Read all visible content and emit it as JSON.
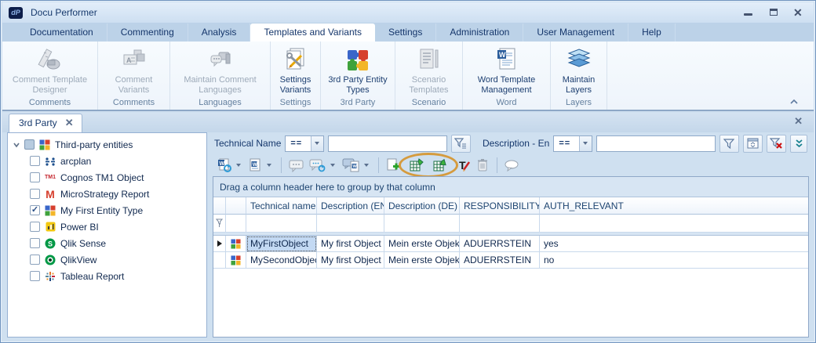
{
  "window": {
    "title": "Docu Performer",
    "logo_text": "dP"
  },
  "menu_tabs": [
    {
      "label": "Documentation"
    },
    {
      "label": "Commenting"
    },
    {
      "label": "Analysis"
    },
    {
      "label": "Templates and Variants"
    },
    {
      "label": "Settings"
    },
    {
      "label": "Administration"
    },
    {
      "label": "User Management"
    },
    {
      "label": "Help"
    }
  ],
  "ribbon": {
    "buttons": [
      {
        "label": "Comment Template Designer",
        "caption": "Comments",
        "disabled": true
      },
      {
        "label": "Comment Variants",
        "caption": "Comments",
        "disabled": true
      },
      {
        "label": "Maintain Comment Languages",
        "caption": "Languages",
        "disabled": true
      },
      {
        "label": "Settings Variants",
        "caption": "Settings",
        "disabled": false
      },
      {
        "label": "3rd Party Entity Types",
        "caption": "3rd Party",
        "disabled": false
      },
      {
        "label": "Scenario Templates",
        "caption": "Scenario",
        "disabled": true
      },
      {
        "label": "Word Template Management",
        "caption": "Word",
        "disabled": false
      },
      {
        "label": "Maintain Layers",
        "caption": "Layers",
        "disabled": false
      }
    ],
    "word_icon_letter": "W"
  },
  "doc_tab": {
    "label": "3rd Party"
  },
  "tree": {
    "root": {
      "label": "Third-party entities",
      "checkbox_state": "indeterminate"
    },
    "items": [
      {
        "label": "arcplan",
        "checked": false,
        "icon": "arcplan-icon"
      },
      {
        "label": "Cognos TM1 Object",
        "checked": false,
        "icon": "tm1-icon",
        "icon_text": "TM1"
      },
      {
        "label": "MicroStrategy Report",
        "checked": false,
        "icon": "microstrategy-icon",
        "icon_text": "M"
      },
      {
        "label": "My First Entity Type",
        "checked": true,
        "icon": "puzzle-icon"
      },
      {
        "label": "Power BI",
        "checked": false,
        "icon": "powerbi-icon"
      },
      {
        "label": "Qlik Sense",
        "checked": false,
        "icon": "qlik-sense-icon",
        "icon_text": "S"
      },
      {
        "label": "QlikView",
        "checked": false,
        "icon": "qlikview-icon"
      },
      {
        "label": "Tableau Report",
        "checked": false,
        "icon": "tableau-icon"
      }
    ]
  },
  "filter_bar": {
    "field1_label": "Technical Name",
    "field1_operator": "==",
    "field1_value": "",
    "field2_label": "Description - En",
    "field2_operator": "==",
    "field2_value": ""
  },
  "toolbar": {
    "text_edit_letter": "T"
  },
  "grid": {
    "group_hint": "Drag a column header here to group by that column",
    "columns": [
      "Technical name",
      "Description (EN)",
      "Description (DE)",
      "RESPONSIBILITY",
      "AUTH_RELEVANT"
    ],
    "rows": [
      {
        "technical_name": "MyFirstObject",
        "description_en": "My first Object",
        "description_de": "Mein erste Objekt",
        "responsibility": "ADUERRSTEIN",
        "auth_relevant": "yes",
        "selected": true
      },
      {
        "technical_name": "MySecondObject",
        "description_en": "My first Object",
        "description_de": "Mein erste Objekt",
        "responsibility": "ADUERRSTEIN",
        "auth_relevant": "no",
        "selected": false
      }
    ]
  },
  "colors": {
    "annotation_orange": "#d59b3e",
    "selection_blue": "#c3d9f3",
    "accent_navy": "#173a6d",
    "excel_green": "#1e7145",
    "qlik_green": "#009845",
    "powerbi_yellow": "#f2c811",
    "brand_red": "#d6402e"
  }
}
